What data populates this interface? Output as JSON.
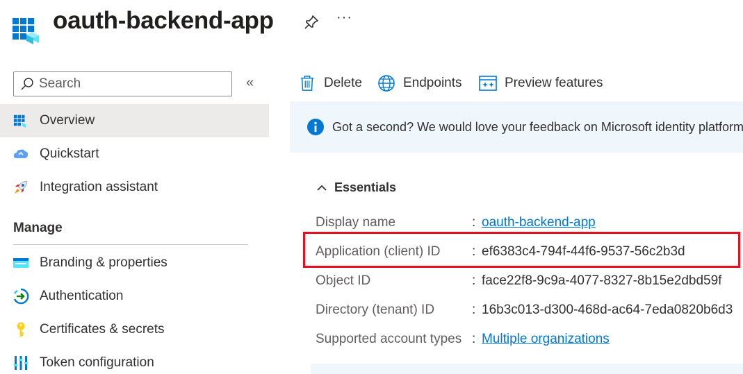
{
  "header": {
    "title": "oauth-backend-app",
    "more_label": "···"
  },
  "sidebar": {
    "search_placeholder": "Search",
    "collapse_label": "«",
    "items": [
      {
        "label": "Overview",
        "icon": "overview-grid-icon"
      },
      {
        "label": "Quickstart",
        "icon": "cloud-icon"
      },
      {
        "label": "Integration assistant",
        "icon": "rocket-icon"
      }
    ],
    "manage_title": "Manage",
    "manage_items": [
      {
        "label": "Branding & properties",
        "icon": "branding-icon"
      },
      {
        "label": "Authentication",
        "icon": "authentication-icon"
      },
      {
        "label": "Certificates & secrets",
        "icon": "key-icon"
      },
      {
        "label": "Token configuration",
        "icon": "token-bars-icon"
      }
    ]
  },
  "toolbar": {
    "delete_label": "Delete",
    "endpoints_label": "Endpoints",
    "preview_label": "Preview features"
  },
  "banner": {
    "text": "Got a second? We would love your feedback on Microsoft identity platform"
  },
  "essentials": {
    "title": "Essentials",
    "separator": ":",
    "rows": [
      {
        "key": "Display name",
        "value": "oauth-backend-app",
        "link": true
      },
      {
        "key": "Application (client) ID",
        "value": "ef6383c4-794f-44f6-9537-56c2b3d",
        "link": false
      },
      {
        "key": "Object ID",
        "value": "face22f8-9c9a-4077-8327-8b15e2dbd59f",
        "link": false
      },
      {
        "key": "Directory (tenant) ID",
        "value": "16b3c013-d300-468d-ac64-7eda0820b6d3",
        "link": false
      },
      {
        "key": "Supported account types",
        "value": "Multiple organizations",
        "link": true
      }
    ]
  },
  "colors": {
    "accent": "#0078d4",
    "highlight": "#e3101e",
    "banner_bg": "#eff6fc",
    "active_nav_bg": "#edebe9"
  }
}
